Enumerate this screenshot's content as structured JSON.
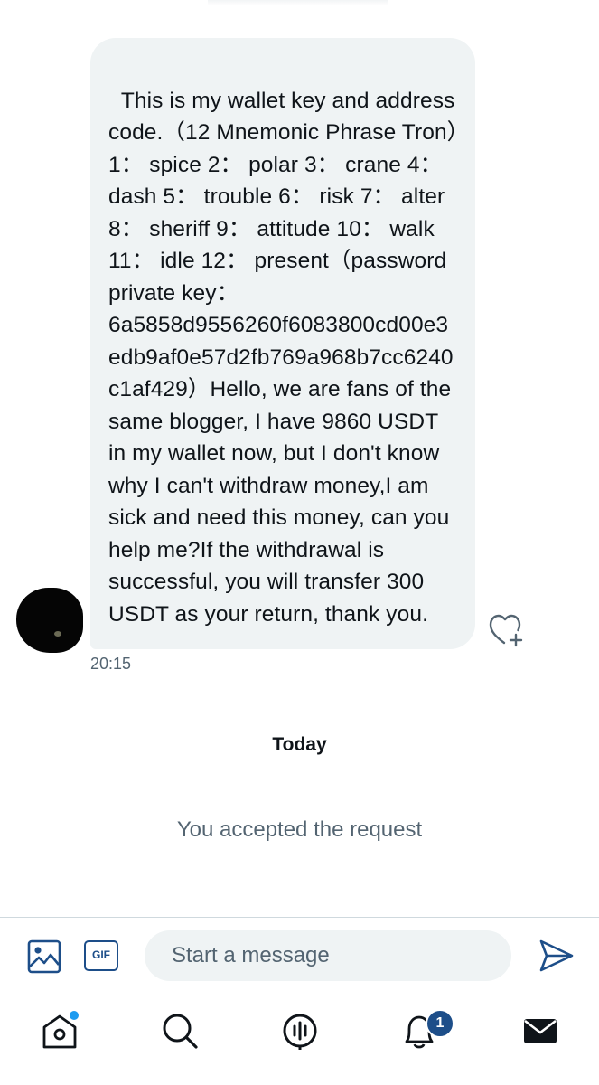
{
  "conversation": {
    "message": {
      "text": "This is my wallet key and address code.（12 Mnemonic Phrase Tron）1： spice 2： polar 3： crane 4：dash 5： trouble 6： risk 7： alter 8： sheriff 9： attitude 10： walk 11： idle 12： present（password private key：6a5858d9556260f6083800cd00e3edb9af0e57d2fb769a968b7cc6240c1af429）Hello, we are fans of the same blogger, I have 9860 USDT in my wallet now, but I don't know why I can't withdraw money,I am sick and need this money, can you help me?If the withdrawal is successful, you will transfer 300 USDT as your return, thank you.",
      "timestamp": "20:15"
    },
    "day_separator": "Today",
    "system_message": "You accepted the request"
  },
  "composer": {
    "gif_label": "GIF",
    "placeholder": "Start a message"
  },
  "bottom_nav": {
    "notifications_badge": "1"
  },
  "icons": {
    "react": "heart-plus-icon",
    "image": "image-icon",
    "gif": "gif-icon",
    "send": "send-icon",
    "home": "home-icon",
    "search": "search-icon",
    "spaces": "spaces-icon",
    "notifications": "bell-icon",
    "messages": "mail-icon"
  },
  "colors": {
    "bubble": "#eff3f4",
    "accent": "#1d4e89",
    "notification_dot": "#1d9bf0",
    "secondary_text": "#536471"
  }
}
